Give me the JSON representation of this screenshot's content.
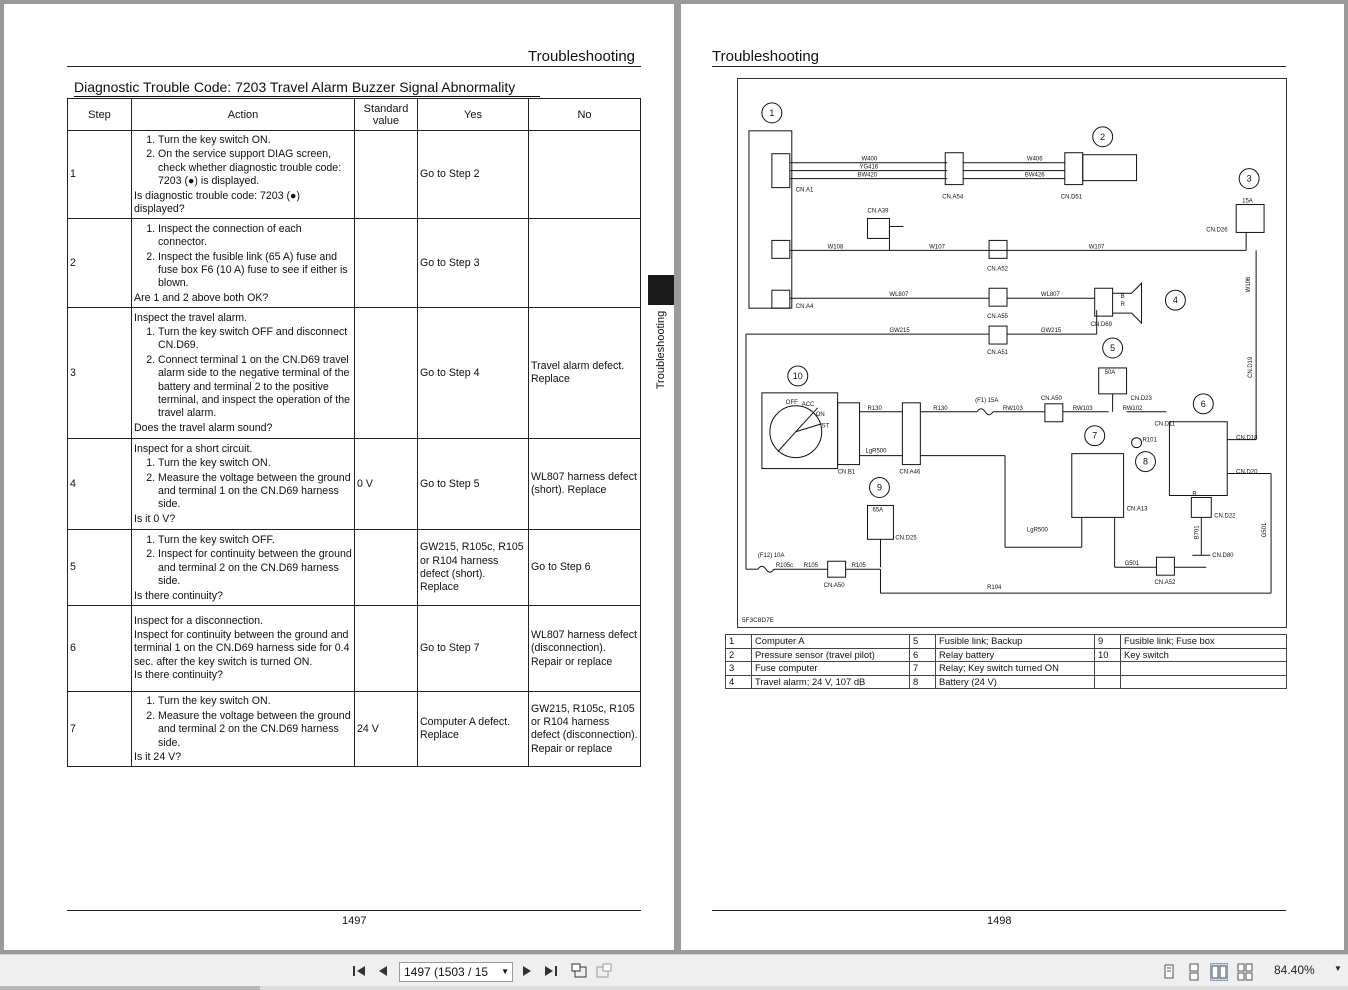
{
  "left_page": {
    "header": "Troubleshooting",
    "title": "Diagnostic Trouble Code: 7203 Travel Alarm Buzzer Signal Abnormality",
    "columns": [
      "Step",
      "Action",
      "Standard value",
      "Yes",
      "No"
    ],
    "rows": [
      {
        "step": "1",
        "intro": "",
        "items": [
          "Turn the key switch ON.",
          "On the service support DIAG screen, check whether diagnostic trouble code: 7203 (●) is displayed."
        ],
        "question": "Is diagnostic trouble code: 7203 (●) displayed?",
        "std": "",
        "yes": "Go to Step 2",
        "no": ""
      },
      {
        "step": "2",
        "intro": "",
        "items": [
          "Inspect the connection of each connector.",
          "Inspect the fusible link (65 A) fuse and fuse box F6 (10 A) fuse to see if either is blown."
        ],
        "question": "Are 1 and 2 above both OK?",
        "std": "",
        "yes": "Go to Step 3",
        "no": ""
      },
      {
        "step": "3",
        "intro": "Inspect the travel alarm.",
        "items": [
          "Turn the key switch OFF and disconnect CN.D69.",
          "Connect terminal 1 on the CN.D69 travel alarm side to the negative terminal of the battery and terminal 2 to the positive terminal, and inspect the operation of the travel alarm."
        ],
        "question": "Does the travel alarm sound?",
        "std": "",
        "yes": "Go to Step 4",
        "no": "Travel alarm defect. Replace"
      },
      {
        "step": "4",
        "intro": "Inspect for a short circuit.",
        "items": [
          "Turn the key switch ON.",
          "Measure the voltage between the ground and terminal 1 on the CN.D69 harness side."
        ],
        "question": "Is it 0 V?",
        "std": "0 V",
        "yes": "Go to Step 5",
        "no": "WL807 harness defect (short). Replace"
      },
      {
        "step": "5",
        "intro": "",
        "items": [
          "Turn the key switch OFF.",
          "Inspect for continuity between the ground and terminal 2 on the CN.D69 harness side."
        ],
        "question": "Is there continuity?",
        "std": "",
        "yes": "GW215, R105c, R105 or R104 harness defect (short). Replace",
        "no": "Go to Step 6"
      },
      {
        "step": "6",
        "intro": "Inspect for a disconnection.",
        "items": [],
        "body": "Inspect for continuity between the ground and terminal 1 on the CN.D69 harness side for 0.4 sec. after the key switch is turned ON.",
        "question": "Is there continuity?",
        "std": "",
        "yes": "Go to Step 7",
        "no": "WL807 harness defect (disconnection). Repair or replace"
      },
      {
        "step": "7",
        "intro": "",
        "items": [
          "Turn the key switch ON.",
          "Measure the voltage between the ground and terminal 2 on the CN.D69 harness side."
        ],
        "question": "Is it 24 V?",
        "std": "24 V",
        "yes": "Computer A defect. Replace",
        "no": "GW215, R105c, R105 or R104 harness defect (disconnection). Repair or replace"
      }
    ],
    "side_label": "Troubleshooting",
    "page_number": "1497"
  },
  "right_page": {
    "header": "Troubleshooting",
    "diagram": {
      "code": "5F3C8D7E",
      "numbers": [
        "1",
        "2",
        "3",
        "4",
        "5",
        "6",
        "7",
        "8",
        "9",
        "10"
      ],
      "connectors": [
        "CN.A1",
        "CN.A54",
        "CN.D51",
        "CN.A39",
        "CN.A52",
        "CN.D26",
        "CN.A4",
        "CN.A55",
        "CN.D69",
        "CN.A51",
        "CN.A50",
        "CN.D23",
        "CN.B1",
        "CN.A46",
        "CN.D18",
        "CN.D20",
        "CN.A13",
        "CN.D22",
        "CN.D25",
        "CN.D80",
        "CN.A50",
        "CN.A52",
        "CN.D11",
        "CN.D19"
      ],
      "wires": [
        "W400",
        "YG416",
        "BW420",
        "W406",
        "BW426",
        "W108",
        "W107",
        "W107",
        "WL807",
        "WL807",
        "GW215",
        "GW215",
        "R130",
        "R130",
        "RW103",
        "RW103",
        "RW102",
        "R101",
        "LgR500",
        "LgR500",
        "R105c",
        "R105",
        "R105",
        "R104",
        "G501",
        "G501",
        "W106",
        "B701"
      ],
      "labels": [
        "OFF",
        "ACC",
        "ON",
        "ST",
        "(F1) 15A",
        "15A",
        "50A",
        "65A",
        "(F12) 10A",
        "B",
        "R",
        "B"
      ]
    },
    "legend": [
      [
        "1",
        "Computer A",
        "5",
        "Fusible link; Backup",
        "9",
        "Fusible link; Fuse box"
      ],
      [
        "2",
        "Pressure sensor (travel pilot)",
        "6",
        "Relay battery",
        "10",
        "Key switch"
      ],
      [
        "3",
        "Fuse computer",
        "7",
        "Relay; Key switch turned ON",
        "",
        ""
      ],
      [
        "4",
        "Travel alarm; 24 V, 107 dB",
        "8",
        "Battery (24 V)",
        "",
        ""
      ]
    ],
    "page_number": "1498"
  },
  "toolbar": {
    "page_field": "1497 (1503 / 15",
    "zoom": "84.40%",
    "icons": [
      "first-page-icon",
      "prev-page-icon",
      "next-page-icon",
      "last-page-icon",
      "previous-view-icon",
      "next-view-icon",
      "single-page-icon",
      "continuous-icon",
      "facing-icon",
      "continuous-facing-icon"
    ]
  },
  "colors": {
    "background": "#9a9a9a",
    "page": "#ffffff",
    "ink": "#111111",
    "toolbar": "#efefef"
  }
}
